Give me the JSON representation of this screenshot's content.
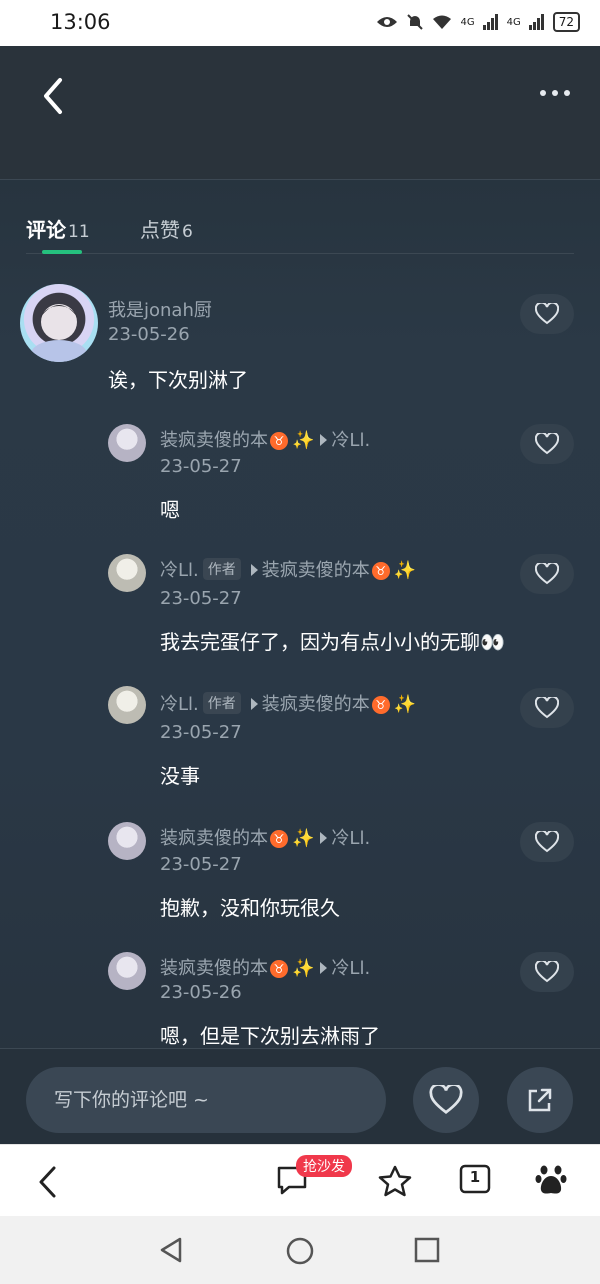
{
  "status_bar": {
    "time": "13:06",
    "signal1": "4G",
    "signal2": "4G",
    "battery": "72"
  },
  "tabs": [
    {
      "label": "评论",
      "count": "11"
    },
    {
      "label": "点赞",
      "count": "6"
    }
  ],
  "top_comment": {
    "name": "我是jonah厨",
    "date": "23-05-26",
    "text": "诶，下次别淋了"
  },
  "replies": [
    {
      "name": "装疯卖傻的本",
      "badge": "♉",
      "sparkle": "✨",
      "reply_to": "冷Ll.",
      "author_tag": "",
      "date": "23-05-27",
      "text": "嗯"
    },
    {
      "name": "冷Ll.",
      "badge": "",
      "sparkle": "",
      "reply_to": "装疯卖傻的本",
      "reply_to_badge": "♉",
      "reply_to_sparkle": "✨",
      "author_tag": "作者",
      "date": "23-05-27",
      "text": "我去完蛋仔了，因为有点小小的无聊👀"
    },
    {
      "name": "冷Ll.",
      "badge": "",
      "sparkle": "",
      "reply_to": "装疯卖傻的本",
      "reply_to_badge": "♉",
      "reply_to_sparkle": "✨",
      "author_tag": "作者",
      "date": "23-05-27",
      "text": "没事"
    },
    {
      "name": "装疯卖傻的本",
      "badge": "♉",
      "sparkle": "✨",
      "reply_to": "冷Ll.",
      "author_tag": "",
      "date": "23-05-27",
      "text": "抱歉，没和你玩很久"
    },
    {
      "name": "装疯卖傻的本",
      "badge": "♉",
      "sparkle": "✨",
      "reply_to": "冷Ll.",
      "author_tag": "",
      "date": "23-05-26",
      "text": "嗯，但是下次别去淋雨了"
    }
  ],
  "input": {
    "placeholder": "写下你的评论吧 ~"
  },
  "browser_bar": {
    "sofa_badge": "抢沙发",
    "tab_count": "1"
  },
  "colors": {
    "accent": "#25c07e",
    "background": "#2a3846",
    "badge": "#f0384b"
  }
}
